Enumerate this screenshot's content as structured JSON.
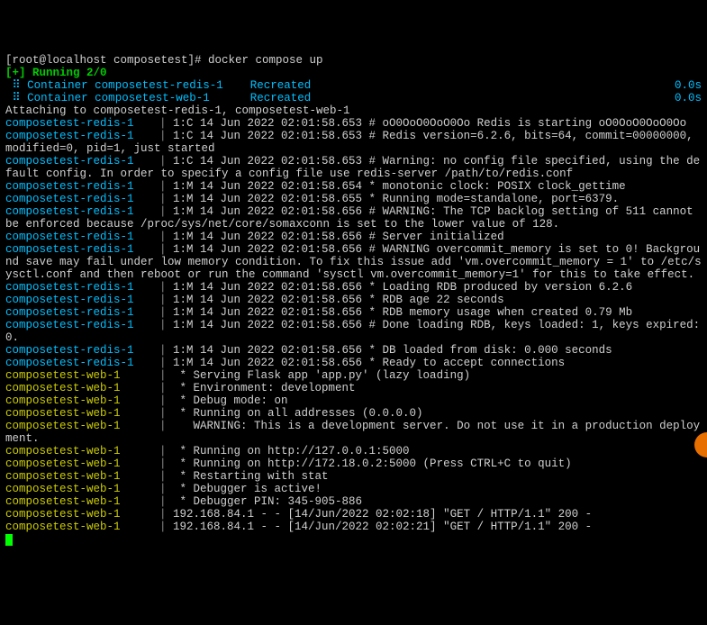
{
  "prompt": "[root@localhost composetest]# docker compose up",
  "status_line": "[+] Running 2/0",
  "containers": [
    {
      "name": "Container composetest-redis-1",
      "state": "Recreated",
      "time": "0.0s"
    },
    {
      "name": "Container composetest-web-1",
      "state": "Recreated",
      "time": "0.0s"
    }
  ],
  "attach": "Attaching to composetest-redis-1, composetest-web-1",
  "r": [
    "1:C 14 Jun 2022 02:01:58.653 # oO0OoO0OoO0Oo Redis is starting oO0OoO0OoO0Oo",
    "1:C 14 Jun 2022 02:01:58.653 # Redis version=6.2.6, bits=64, commit=00000000, modified=0, pid=1, just started",
    "1:C 14 Jun 2022 02:01:58.653 # Warning: no config file specified, using the default config. In order to specify a config file use redis-server /path/to/redis.conf",
    "1:M 14 Jun 2022 02:01:58.654 * monotonic clock: POSIX clock_gettime",
    "1:M 14 Jun 2022 02:01:58.655 * Running mode=standalone, port=6379.",
    "1:M 14 Jun 2022 02:01:58.656 # WARNING: The TCP backlog setting of 511 cannot be enforced because /proc/sys/net/core/somaxconn is set to the lower value of 128.",
    "1:M 14 Jun 2022 02:01:58.656 # Server initialized",
    "1:M 14 Jun 2022 02:01:58.656 # WARNING overcommit_memory is set to 0! Background save may fail under low memory condition. To fix this issue add 'vm.overcommit_memory = 1' to /etc/sysctl.conf and then reboot or run the command 'sysctl vm.overcommit_memory=1' for this to take effect.",
    "1:M 14 Jun 2022 02:01:58.656 * Loading RDB produced by version 6.2.6",
    "1:M 14 Jun 2022 02:01:58.656 * RDB age 22 seconds",
    "1:M 14 Jun 2022 02:01:58.656 * RDB memory usage when created 0.79 Mb",
    "1:M 14 Jun 2022 02:01:58.656 # Done loading RDB, keys loaded: 1, keys expired: 0.",
    "1:M 14 Jun 2022 02:01:58.656 * DB loaded from disk: 0.000 seconds",
    "1:M 14 Jun 2022 02:01:58.656 * Ready to accept connections"
  ],
  "w": [
    " * Serving Flask app 'app.py' (lazy loading)",
    " * Environment: development",
    " * Debug mode: on",
    " * Running on all addresses (0.0.0.0)",
    "   WARNING: This is a development server. Do not use it in a production deployment.",
    " * Running on http://127.0.0.1:5000",
    " * Running on http://172.18.0.2:5000 (Press CTRL+C to quit)",
    " * Restarting with stat",
    " * Debugger is active!",
    " * Debugger PIN: 345-905-886",
    "192.168.84.1 - - [14/Jun/2022 02:02:18] \"GET / HTTP/1.1\" 200 -",
    "192.168.84.1 - - [14/Jun/2022 02:02:21] \"GET / HTTP/1.1\" 200 -"
  ],
  "svc_redis": "composetest-redis-1",
  "svc_web": "composetest-web-1",
  "pipe": "  | "
}
